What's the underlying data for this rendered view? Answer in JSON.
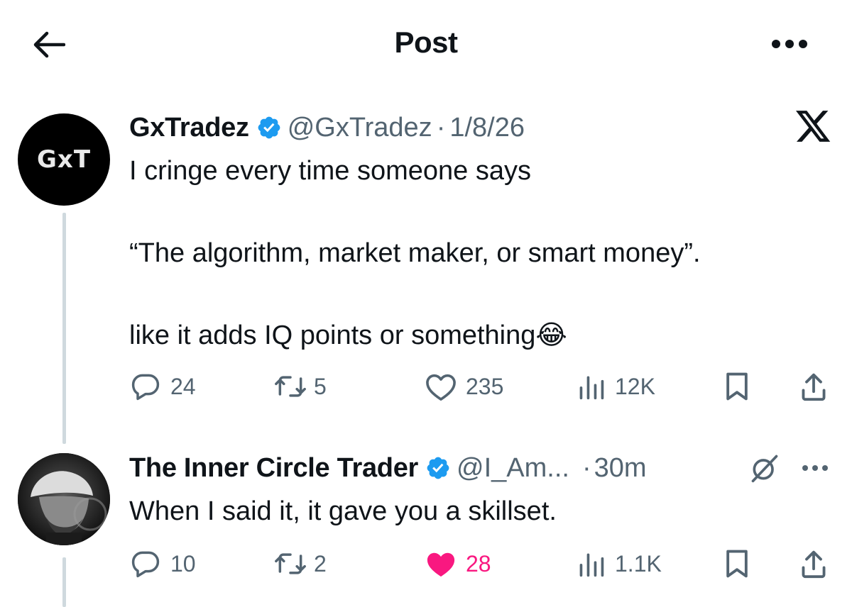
{
  "header": {
    "title": "Post",
    "back_icon": "arrow-left-icon",
    "more_icon": "more-horizontal-icon"
  },
  "colors": {
    "text": "#0f1419",
    "muted": "#536471",
    "verified": "#1d9bf0",
    "like_active": "#f91880",
    "thread_line": "#cfd9de"
  },
  "post": {
    "avatar_text": "GxT",
    "display_name": "GxTradez",
    "handle": "@GxTradez",
    "separator": "·",
    "date": "1/8/26",
    "platform_icon": "x-logo-icon",
    "body": "I cringe every time someone says\n\n“The algorithm, market maker, or smart money”.\n\nlike it adds IQ points or something😂",
    "stats": {
      "replies": "24",
      "reposts": "5",
      "likes": "235",
      "views": "12K"
    }
  },
  "reply": {
    "display_name": "The Inner Circle Trader",
    "handle": "@I_Am...",
    "separator": "·",
    "time": "30m",
    "body": "When I said it, it gave you a skillset.",
    "stats": {
      "replies": "10",
      "reposts": "2",
      "likes": "28",
      "views": "1.1K"
    },
    "liked": true
  }
}
